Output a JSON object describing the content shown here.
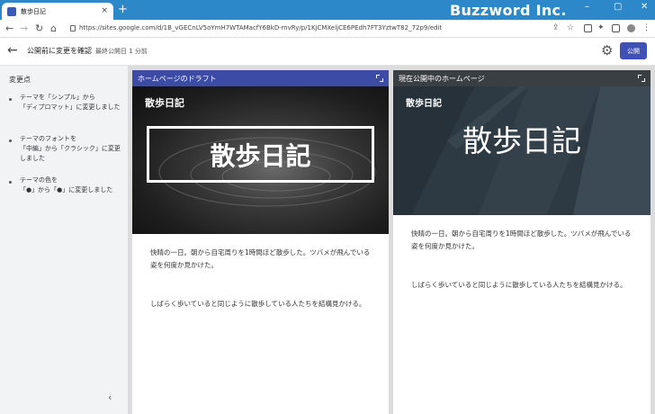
{
  "browser": {
    "tab_title": "散歩日記",
    "tab_close": "×",
    "new_tab": "+",
    "brand": "Buzzword Inc.",
    "url": "https://sites.google.com/d/1B_vGECnLV5oYmH7WTAMacfY6BkD-mvRy/p/1KjCMXeljCE6PEdh7FT3YztwT82_72p9/edit",
    "win_min": "–",
    "win_max": "▢",
    "win_close": "✕",
    "nav_back": "←",
    "nav_forward": "→",
    "nav_reload": "↻",
    "nav_home": "⌂"
  },
  "header": {
    "back_icon": "←",
    "title": "公開前に変更を確認",
    "last_published": "最終公開日 1 分前",
    "settings_icon": "⚙",
    "publish_label": "公開"
  },
  "sidebar": {
    "title": "変更点",
    "changes": [
      {
        "line1": "テーマを「シンプル」から",
        "line2": "「ディプロマット」に変更しました"
      },
      {
        "line1": "テーマのフォントを",
        "line2": "「中編」から「クラシック」に変更しました"
      },
      {
        "line1": "テーマの色を",
        "line2": "「●」から「●」に変更しました"
      }
    ],
    "collapse_icon": "‹"
  },
  "draft": {
    "label": "ホームページのドラフト",
    "header_color": "#3c4ba6",
    "site_name": "散歩日記",
    "hero_title": "散歩日記",
    "para1": "快晴の一日。朝から自宅周りを1時間ほど散歩した。ツバメが飛んでいる姿を何度か見かけた。",
    "para2": "しばらく歩いていると同じように散歩している人たちを結構見かける。"
  },
  "live": {
    "label": "現在公開中のホームページ",
    "header_color": "#3a3f44",
    "site_name": "散歩日記",
    "hero_title": "散歩日記",
    "para1": "快晴の一日。朝から自宅周りを1時間ほど散歩した。ツバメが飛んでいる姿を何度か見かけた。",
    "para2": "しばらく歩いていると同じように散歩している人たちを結構見かける。"
  }
}
